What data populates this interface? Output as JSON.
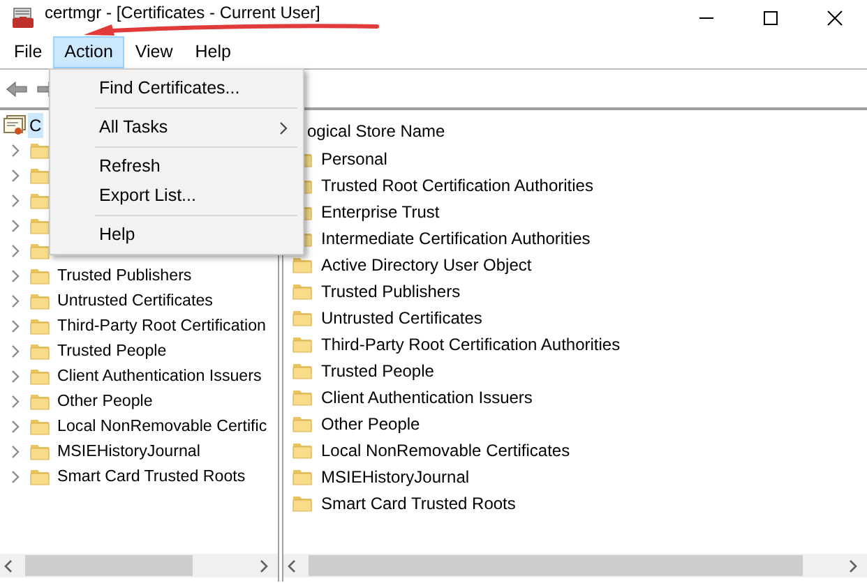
{
  "window": {
    "title": "certmgr - [Certificates - Current User]"
  },
  "menu_bar": [
    {
      "label": "File",
      "selected": false
    },
    {
      "label": "Action",
      "selected": true
    },
    {
      "label": "View",
      "selected": false
    },
    {
      "label": "Help",
      "selected": false
    }
  ],
  "action_menu": [
    {
      "kind": "item",
      "label": "Find Certificates..."
    },
    {
      "kind": "separator"
    },
    {
      "kind": "submenu",
      "label": "All Tasks"
    },
    {
      "kind": "separator"
    },
    {
      "kind": "item",
      "label": "Refresh"
    },
    {
      "kind": "item",
      "label": "Export List..."
    },
    {
      "kind": "separator"
    },
    {
      "kind": "item",
      "label": "Help"
    }
  ],
  "tree": {
    "root": {
      "label": "C",
      "selected": true,
      "children": [
        {
          "kind": "hidden"
        },
        {
          "kind": "hidden"
        },
        {
          "kind": "hidden"
        },
        {
          "kind": "hidden"
        },
        {
          "kind": "hidden"
        },
        {
          "kind": "folder",
          "label": "Trusted Publishers"
        },
        {
          "kind": "folder",
          "label": "Untrusted Certificates"
        },
        {
          "kind": "folder",
          "label": "Third-Party Root Certification"
        },
        {
          "kind": "folder",
          "label": "Trusted People"
        },
        {
          "kind": "folder",
          "label": "Client Authentication Issuers"
        },
        {
          "kind": "folder",
          "label": "Other People"
        },
        {
          "kind": "folder",
          "label": "Local NonRemovable Certific"
        },
        {
          "kind": "folder",
          "label": "MSIEHistoryJournal"
        },
        {
          "kind": "folder",
          "label": "Smart Card Trusted Roots"
        }
      ]
    }
  },
  "store_list": {
    "column": "ogical Store Name",
    "items": [
      "Personal",
      "Trusted Root Certification Authorities",
      "Enterprise Trust",
      "Intermediate Certification Authorities",
      "Active Directory User Object",
      "Trusted Publishers",
      "Untrusted Certificates",
      "Third-Party Root Certification Authorities",
      "Trusted People",
      "Client Authentication Issuers",
      "Other People",
      "Local NonRemovable Certificates",
      "MSIEHistoryJournal",
      "Smart Card Trusted Roots"
    ]
  }
}
